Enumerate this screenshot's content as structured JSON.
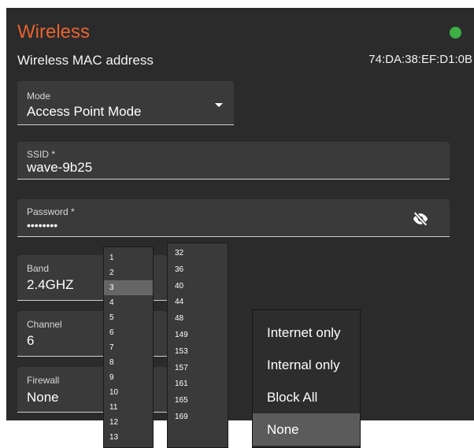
{
  "header": {
    "title": "Wireless",
    "status_color": "#3cb043",
    "mac_label": "Wireless MAC address",
    "mac_value": "74:DA:38:EF:D1:0B"
  },
  "fields": {
    "mode": {
      "label": "Mode",
      "value": "Access Point Mode"
    },
    "ssid": {
      "label": "SSID *",
      "value": "wave-9b25"
    },
    "password": {
      "label": "Password *",
      "value": "••••••••",
      "icon": "eye-off-icon"
    },
    "band": {
      "label": "Band",
      "value": "2.4GHZ"
    },
    "channel": {
      "label": "Channel",
      "value": "6"
    },
    "firewall": {
      "label": "Firewall",
      "value": "None"
    }
  },
  "channel_list_24": {
    "items": [
      "1",
      "2",
      "3",
      "4",
      "5",
      "6",
      "7",
      "8",
      "9",
      "10",
      "11",
      "12",
      "13"
    ],
    "selected": "3"
  },
  "channel_list_5": {
    "items": [
      "32",
      "36",
      "40",
      "44",
      "48",
      "149",
      "153",
      "157",
      "161",
      "165",
      "169"
    ]
  },
  "firewall_menu": {
    "items": [
      "Internet only",
      "Internal only",
      "Block All",
      "None"
    ],
    "selected": "None"
  }
}
